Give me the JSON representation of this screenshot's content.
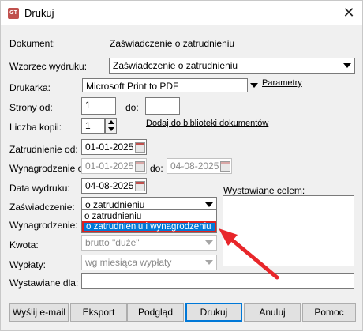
{
  "window": {
    "title": "Drukuj",
    "close_glyph": "✕"
  },
  "form": {
    "dokument_label": "Dokument:",
    "dokument_value": "Zaświadczenie o zatrudnieniu",
    "wzorzec_label": "Wzorzec wydruku:",
    "wzorzec_value": "Zaświadczenie o zatrudnieniu",
    "drukarka_label": "Drukarka:",
    "drukarka_value": "Microsoft Print to PDF",
    "parametry_link": "Parametry",
    "strony_od_label": "Strony od:",
    "strony_od_value": "1",
    "do_label": "do:",
    "strony_do_value": "",
    "kopie_label": "Liczba kopii:",
    "kopie_value": "1",
    "biblioteka_link": "Dodaj do biblioteki dokumentów",
    "zatrudnienie_od_label": "Zatrudnienie od:",
    "zatrudnienie_od_value": "01-01-2025",
    "wynagrodzenie_od_label": "Wynagrodzenie od:",
    "wynagrodzenie_od_value": "01-01-2025",
    "wynagrodzenie_do_label": "do:",
    "wynagrodzenie_do_value": "04-08-2025",
    "data_wydruku_label": "Data wydruku:",
    "data_wydruku_value": "04-08-2025",
    "wystawiane_celem_label": "Wystawiane celem:",
    "zaswiadczenie_label": "Zaświadczenie:",
    "zaswiadczenie_value": "o zatrudnieniu",
    "zaswiadczenie_options": [
      "o zatrudnieniu",
      "o zatrudnieniu i wynagrodzeniu"
    ],
    "wynagrodzenie_label": "Wynagrodzenie:",
    "kwota_label": "Kwota:",
    "kwota_value": "brutto \"duże\"",
    "wyplaty_label": "Wypłaty:",
    "wyplaty_value": "wg miesiąca wypłaty",
    "wystawiane_dla_label": "Wystawiane dla:",
    "wystawiane_dla_value": ""
  },
  "buttons": {
    "email": "Wyślij e-mail",
    "eksport": "Eksport",
    "podglad": "Podgląd",
    "drukuj": "Drukuj",
    "anuluj": "Anuluj",
    "pomoc": "Pomoc"
  },
  "colors": {
    "selection": "#0078d7",
    "highlight_border": "#e02020",
    "annotation_arrow": "#e8262a"
  },
  "icons": {
    "app": "app-icon",
    "calendar": "calendar-icon",
    "close": "close-icon"
  }
}
